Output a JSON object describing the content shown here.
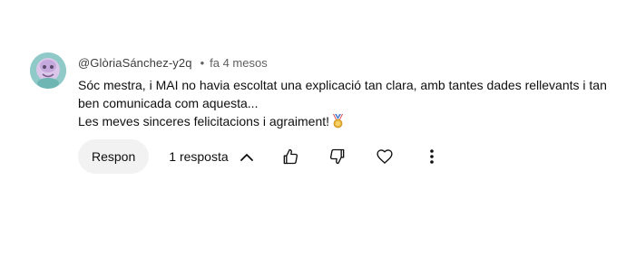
{
  "comment": {
    "author": "@GlòriaSánchez-y2q",
    "separator": "•",
    "timestamp": "fa 4 mesos",
    "text_line_1": "Sóc mestra, i MAI no havia escoltat una explicació tan clara, amb tantes dades rellevants i tan ben comunicada com aquesta...",
    "text_line_2": "Les meves sinceres felicitacions i agraiment!",
    "emoji": "medal-icon"
  },
  "actions": {
    "reply_label": "Respon",
    "replies_label": "1 resposta",
    "icons": [
      "chevron-up-icon",
      "thumb-up-icon",
      "thumb-down-icon",
      "heart-icon",
      "more-vert-icon"
    ]
  },
  "colors": {
    "text": "#0f0f0f",
    "meta": "#606060",
    "button_bg": "#f2f2f2",
    "avatar_bg": "#9ad0cf"
  }
}
